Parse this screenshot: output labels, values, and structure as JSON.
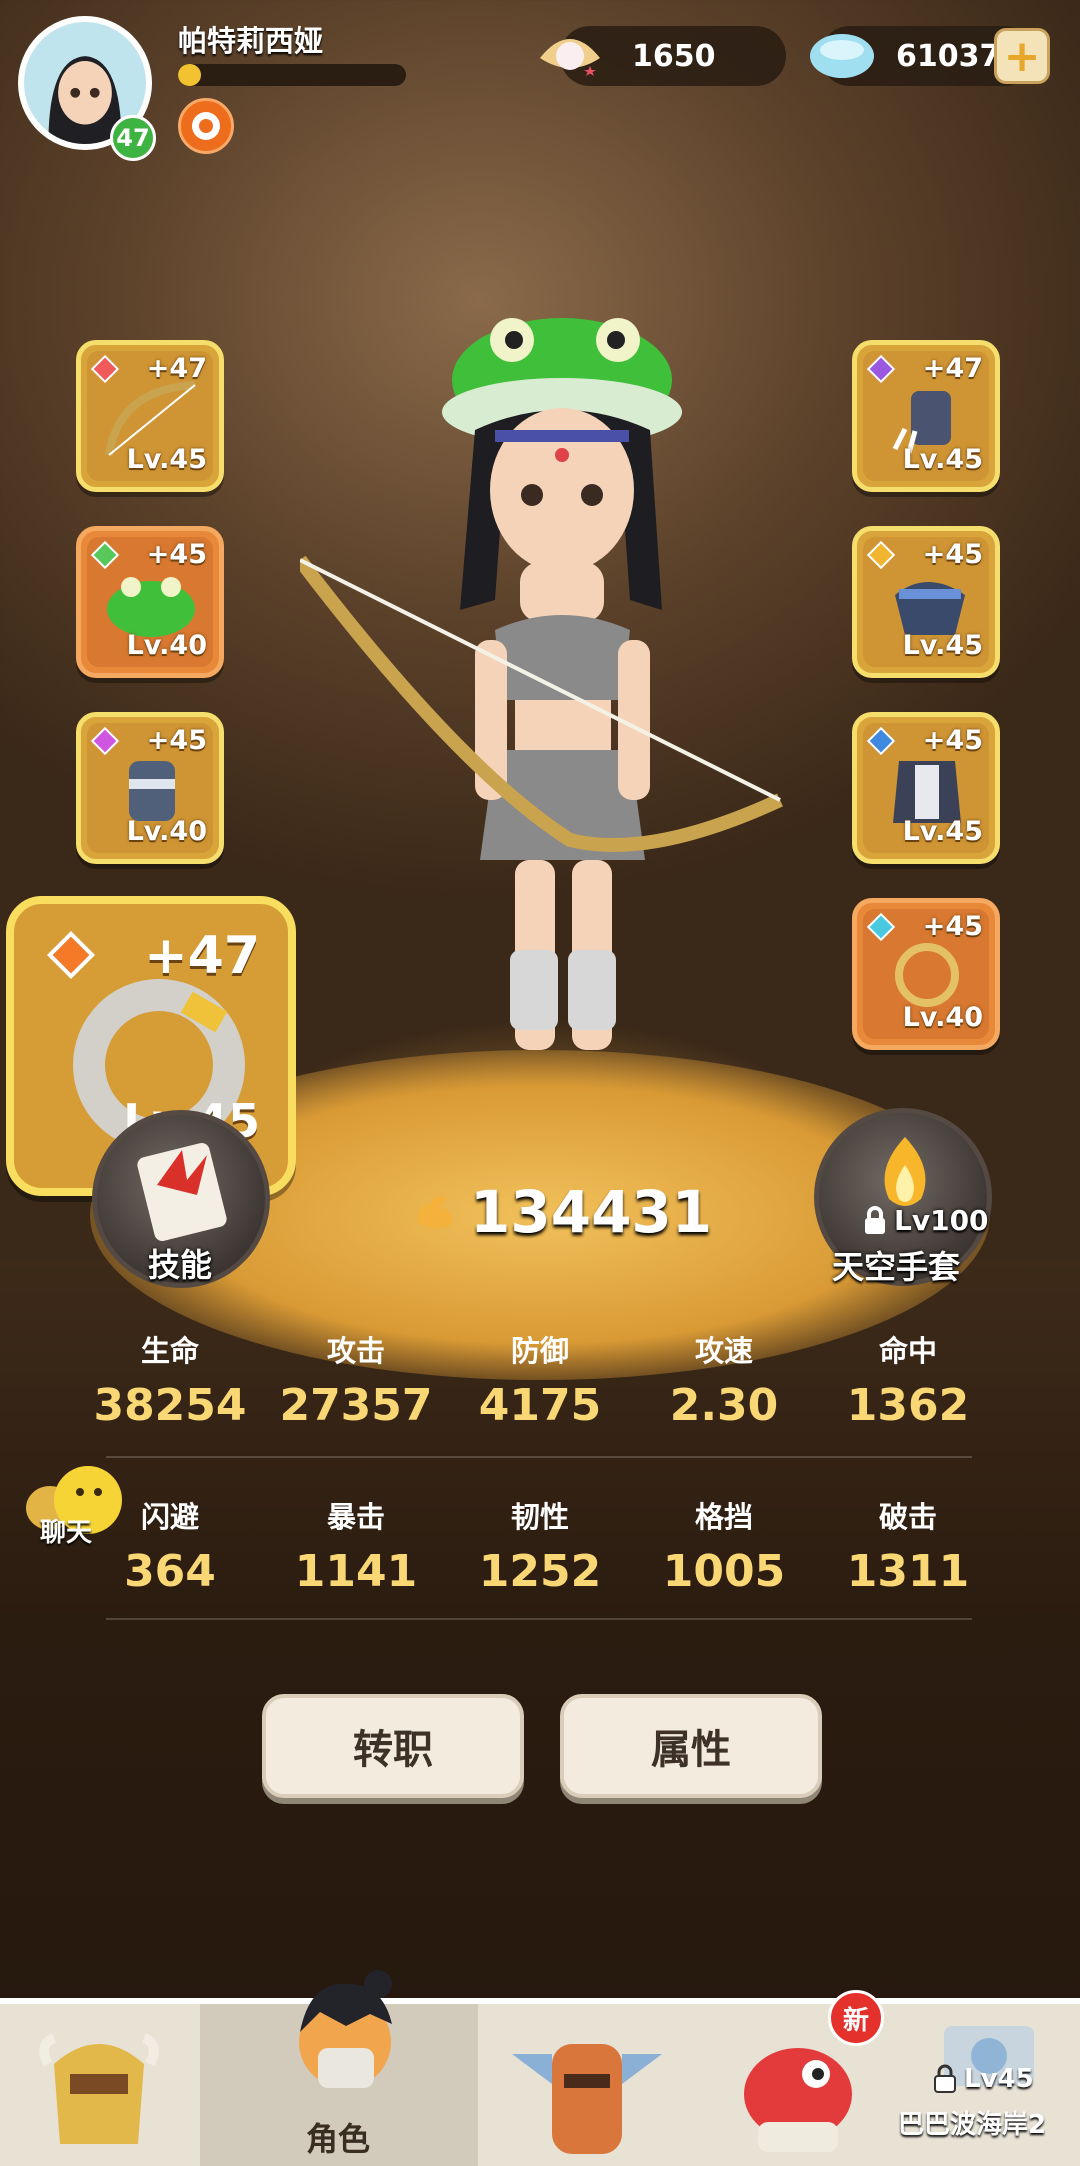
{
  "player": {
    "name": "帕特莉西娅",
    "level": "47",
    "xp_fraction": 0.1
  },
  "currency": {
    "pearl": "1650",
    "gem": "61037"
  },
  "equipment": {
    "left": [
      {
        "plus": "+47",
        "level": "Lv.45",
        "gem_color": "#f05a5a",
        "item": "bow-icon"
      },
      {
        "plus": "+45",
        "level": "Lv.40",
        "gem_color": "#59c85a",
        "item": "frog-helmet-icon"
      },
      {
        "plus": "+45",
        "level": "Lv.40",
        "gem_color": "#cf56e0",
        "item": "bracer-icon"
      }
    ],
    "right": [
      {
        "plus": "+47",
        "level": "Lv.45",
        "gem_color": "#9a57e0",
        "item": "claw-gauntlet-icon"
      },
      {
        "plus": "+45",
        "level": "Lv.45",
        "gem_color": "#f2b52e",
        "item": "shoulder-armor-icon"
      },
      {
        "plus": "+45",
        "level": "Lv.45",
        "gem_color": "#3f8ae0",
        "item": "chest-armor-icon"
      },
      {
        "plus": "+45",
        "level": "Lv.40",
        "gem_color": "#49c9e0",
        "item": "ring-necklace-icon"
      }
    ],
    "featured": {
      "plus": "+47",
      "level": "Lv.45",
      "item": "stone-ring-icon"
    }
  },
  "skill_button": {
    "label": "技能"
  },
  "locked_item": {
    "level": "Lv100",
    "label": "天空手套"
  },
  "combat_power": "134431",
  "stats": [
    {
      "label": "生命",
      "value": "38254"
    },
    {
      "label": "攻击",
      "value": "27357"
    },
    {
      "label": "防御",
      "value": "4175"
    },
    {
      "label": "攻速",
      "value": "2.30"
    },
    {
      "label": "命中",
      "value": "1362"
    },
    {
      "label": "闪避",
      "value": "364"
    },
    {
      "label": "暴击",
      "value": "1141"
    },
    {
      "label": "韧性",
      "value": "1252"
    },
    {
      "label": "格挡",
      "value": "1005"
    },
    {
      "label": "破击",
      "value": "1311"
    }
  ],
  "chat": {
    "label": "聊天"
  },
  "buttons": {
    "class_change": "转职",
    "attributes": "属性"
  },
  "nav": {
    "role_label": "角色",
    "new_badge": "新",
    "locked_level": "Lv45",
    "locked_label": "巴巴波海岸2"
  }
}
